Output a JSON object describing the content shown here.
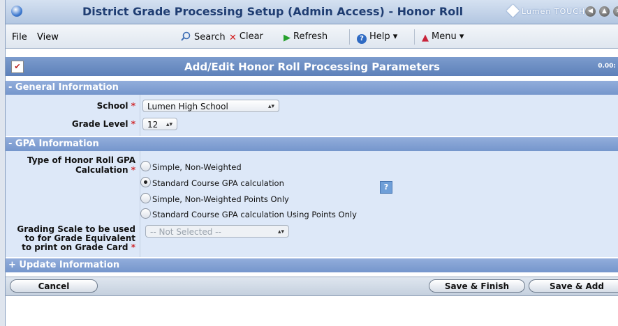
{
  "window": {
    "title": "District Grade Processing Setup (Admin Access) - Honor Roll",
    "logo_text": "Lumen TOUCH"
  },
  "menu": {
    "file": "File",
    "view": "View"
  },
  "toolbar": {
    "search": "Search",
    "clear": "Clear",
    "refresh": "Refresh",
    "help": "Help ▾",
    "menu": "Menu ▾"
  },
  "page": {
    "title": "Add/Edit Honor Roll Processing Parameters",
    "timer": "0.00:"
  },
  "general": {
    "header": "- General Information",
    "school_label": "School",
    "school_value": "Lumen High School",
    "grade_label": "Grade Level",
    "grade_value": "12"
  },
  "gpa": {
    "header": "- GPA Information",
    "type_label_1": "Type of Honor Roll GPA",
    "type_label_2": "Calculation",
    "options": [
      "Simple, Non-Weighted",
      "Standard Course GPA calculation",
      "Simple, Non-Weighted Points Only",
      "Standard Course GPA calculation Using Points Only"
    ],
    "selected_index": 1,
    "help": "?",
    "scale_label_1": "Grading Scale to be used",
    "scale_label_2": "to for Grade Equivalent",
    "scale_label_3": "to print on Grade Card",
    "scale_value": "-- Not Selected --"
  },
  "update": {
    "header": "+ Update Information"
  },
  "buttons": {
    "cancel": "Cancel",
    "save_finish": "Save & Finish",
    "save_add": "Save & Add"
  },
  "required_mark": "*",
  "colors": {
    "accent": "#5d80b9",
    "required": "#d0282b"
  }
}
